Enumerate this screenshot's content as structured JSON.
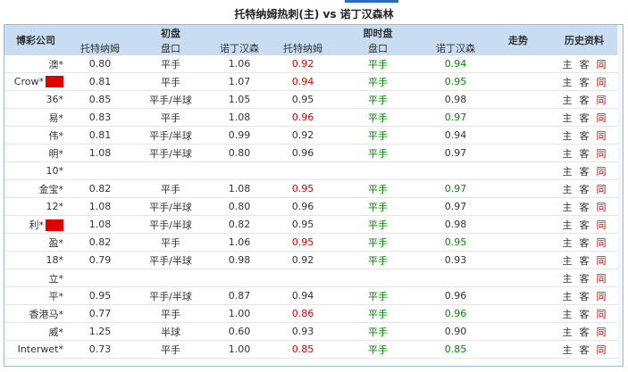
{
  "header": {
    "title": "托特纳姆热刺(主) vs 诺丁汉森林"
  },
  "columns": {
    "company": "博彩公司",
    "initial_group": "初盘",
    "live_group": "即时盘",
    "home": "托特纳姆",
    "handicap": "盘口",
    "away": "诺丁汉森",
    "trend": "走势",
    "history": "历史资料"
  },
  "links": {
    "home": "主",
    "away": "客",
    "same": "同"
  },
  "colors": {
    "header_bg": "#c8ddf2",
    "up": "#e00000",
    "down": "#008a00"
  },
  "rows": [
    {
      "company": "澳*",
      "i_home": "0.80",
      "i_hc": "平手",
      "i_away": "1.06",
      "l_home": "0.92",
      "l_home_c": "red",
      "l_hc": "平手",
      "l_hc_c": "grn",
      "l_away": "0.94",
      "l_away_c": "grn",
      "tag": false
    },
    {
      "company": "Crow*",
      "i_home": "0.81",
      "i_hc": "平手",
      "i_away": "1.07",
      "l_home": "0.94",
      "l_home_c": "red",
      "l_hc": "平手",
      "l_hc_c": "grn",
      "l_away": "0.95",
      "l_away_c": "grn",
      "tag": true
    },
    {
      "company": "36*",
      "i_home": "0.85",
      "i_hc": "平手/半球",
      "i_away": "1.05",
      "l_home": "0.95",
      "l_home_c": "",
      "l_hc": "平手",
      "l_hc_c": "grn",
      "l_away": "0.98",
      "l_away_c": "",
      "tag": false
    },
    {
      "company": "易*",
      "i_home": "0.83",
      "i_hc": "平手",
      "i_away": "1.08",
      "l_home": "0.96",
      "l_home_c": "red",
      "l_hc": "平手",
      "l_hc_c": "grn",
      "l_away": "0.97",
      "l_away_c": "grn",
      "tag": false
    },
    {
      "company": "伟*",
      "i_home": "0.81",
      "i_hc": "平手/半球",
      "i_away": "0.99",
      "l_home": "0.92",
      "l_home_c": "",
      "l_hc": "平手",
      "l_hc_c": "grn",
      "l_away": "0.94",
      "l_away_c": "",
      "tag": false
    },
    {
      "company": "明*",
      "i_home": "1.08",
      "i_hc": "平手/半球",
      "i_away": "0.80",
      "l_home": "0.96",
      "l_home_c": "",
      "l_hc": "平手",
      "l_hc_c": "grn",
      "l_away": "0.97",
      "l_away_c": "",
      "tag": false
    },
    {
      "company": "10*",
      "i_home": "",
      "i_hc": "",
      "i_away": "",
      "l_home": "",
      "l_home_c": "",
      "l_hc": "",
      "l_hc_c": "",
      "l_away": "",
      "l_away_c": "",
      "tag": false
    },
    {
      "company": "金宝*",
      "i_home": "0.82",
      "i_hc": "平手",
      "i_away": "1.08",
      "l_home": "0.95",
      "l_home_c": "red",
      "l_hc": "平手",
      "l_hc_c": "grn",
      "l_away": "0.97",
      "l_away_c": "grn",
      "tag": false
    },
    {
      "company": "12*",
      "i_home": "1.08",
      "i_hc": "平手/半球",
      "i_away": "0.80",
      "l_home": "0.96",
      "l_home_c": "",
      "l_hc": "平手",
      "l_hc_c": "grn",
      "l_away": "0.97",
      "l_away_c": "",
      "tag": false
    },
    {
      "company": "利*",
      "i_home": "1.08",
      "i_hc": "平手/半球",
      "i_away": "0.82",
      "l_home": "0.95",
      "l_home_c": "",
      "l_hc": "平手",
      "l_hc_c": "grn",
      "l_away": "0.98",
      "l_away_c": "",
      "tag": true
    },
    {
      "company": "盈*",
      "i_home": "0.82",
      "i_hc": "平手",
      "i_away": "1.06",
      "l_home": "0.95",
      "l_home_c": "red",
      "l_hc": "平手",
      "l_hc_c": "grn",
      "l_away": "0.95",
      "l_away_c": "grn",
      "tag": false
    },
    {
      "company": "18*",
      "i_home": "0.79",
      "i_hc": "平手/半球",
      "i_away": "0.98",
      "l_home": "0.92",
      "l_home_c": "",
      "l_hc": "平手",
      "l_hc_c": "grn",
      "l_away": "0.93",
      "l_away_c": "",
      "tag": false
    },
    {
      "company": "立*",
      "i_home": "",
      "i_hc": "",
      "i_away": "",
      "l_home": "",
      "l_home_c": "",
      "l_hc": "",
      "l_hc_c": "",
      "l_away": "",
      "l_away_c": "",
      "tag": false
    },
    {
      "company": "平*",
      "i_home": "0.95",
      "i_hc": "平手/半球",
      "i_away": "0.87",
      "l_home": "0.94",
      "l_home_c": "",
      "l_hc": "平手",
      "l_hc_c": "grn",
      "l_away": "0.96",
      "l_away_c": "",
      "tag": false
    },
    {
      "company": "香港马*",
      "i_home": "0.77",
      "i_hc": "平手",
      "i_away": "1.00",
      "l_home": "0.86",
      "l_home_c": "red",
      "l_hc": "平手",
      "l_hc_c": "grn",
      "l_away": "0.96",
      "l_away_c": "grn",
      "tag": false
    },
    {
      "company": "威*",
      "i_home": "1.25",
      "i_hc": "半球",
      "i_away": "0.60",
      "l_home": "0.93",
      "l_home_c": "",
      "l_hc": "平手",
      "l_hc_c": "grn",
      "l_away": "0.90",
      "l_away_c": "",
      "tag": false
    },
    {
      "company": "Interwet*",
      "i_home": "0.73",
      "i_hc": "平手",
      "i_away": "1.00",
      "l_home": "0.85",
      "l_home_c": "red",
      "l_hc": "平手",
      "l_hc_c": "grn",
      "l_away": "0.85",
      "l_away_c": "grn",
      "tag": false
    }
  ]
}
